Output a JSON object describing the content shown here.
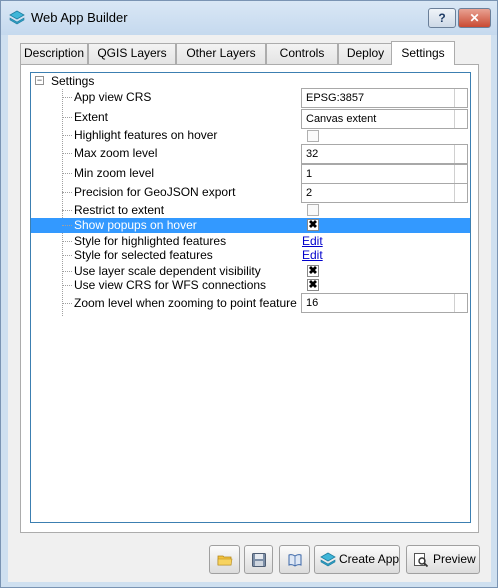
{
  "window": {
    "title": "Web App Builder",
    "help_label": "?",
    "close_label": "✕"
  },
  "tabs": [
    {
      "label": "Description"
    },
    {
      "label": "QGIS Layers"
    },
    {
      "label": "Other Layers"
    },
    {
      "label": "Controls"
    },
    {
      "label": "Deploy"
    },
    {
      "label": "Settings"
    }
  ],
  "active_tab": "Settings",
  "settings": {
    "root_label": "Settings",
    "expander": "−",
    "rows": [
      {
        "label": "App view CRS",
        "type": "text",
        "value": "EPSG:3857"
      },
      {
        "label": "Extent",
        "type": "text",
        "value": "Canvas extent"
      },
      {
        "label": "Highlight features on hover",
        "type": "checkbox",
        "checked": false
      },
      {
        "label": "Max zoom level",
        "type": "text",
        "value": "32"
      },
      {
        "label": "Min zoom level",
        "type": "text",
        "value": "1"
      },
      {
        "label": "Precision for GeoJSON export",
        "type": "text",
        "value": "2"
      },
      {
        "label": "Restrict to extent",
        "type": "checkbox",
        "checked": false
      },
      {
        "label": "Show popups on hover",
        "type": "checkbox",
        "checked": true,
        "selected": true
      },
      {
        "label": "Style for highlighted features",
        "type": "link",
        "value": "Edit"
      },
      {
        "label": "Style for selected features",
        "type": "link",
        "value": "Edit"
      },
      {
        "label": "Use layer scale dependent visibility",
        "type": "checkbox",
        "checked": true
      },
      {
        "label": "Use view CRS for WFS connections",
        "type": "checkbox",
        "checked": true
      },
      {
        "label": "Zoom level when zooming to point feature",
        "type": "text",
        "value": "16"
      }
    ]
  },
  "checkmark": "✖",
  "toolbar": {
    "open_icon": "folder-icon",
    "save_icon": "floppy-disk-icon",
    "help_icon": "book-icon",
    "create_label": "Create App",
    "preview_label": "Preview"
  },
  "colors": {
    "selection": "#3399ff",
    "link": "#0000cc",
    "tree_border": "#3c7fb1"
  }
}
